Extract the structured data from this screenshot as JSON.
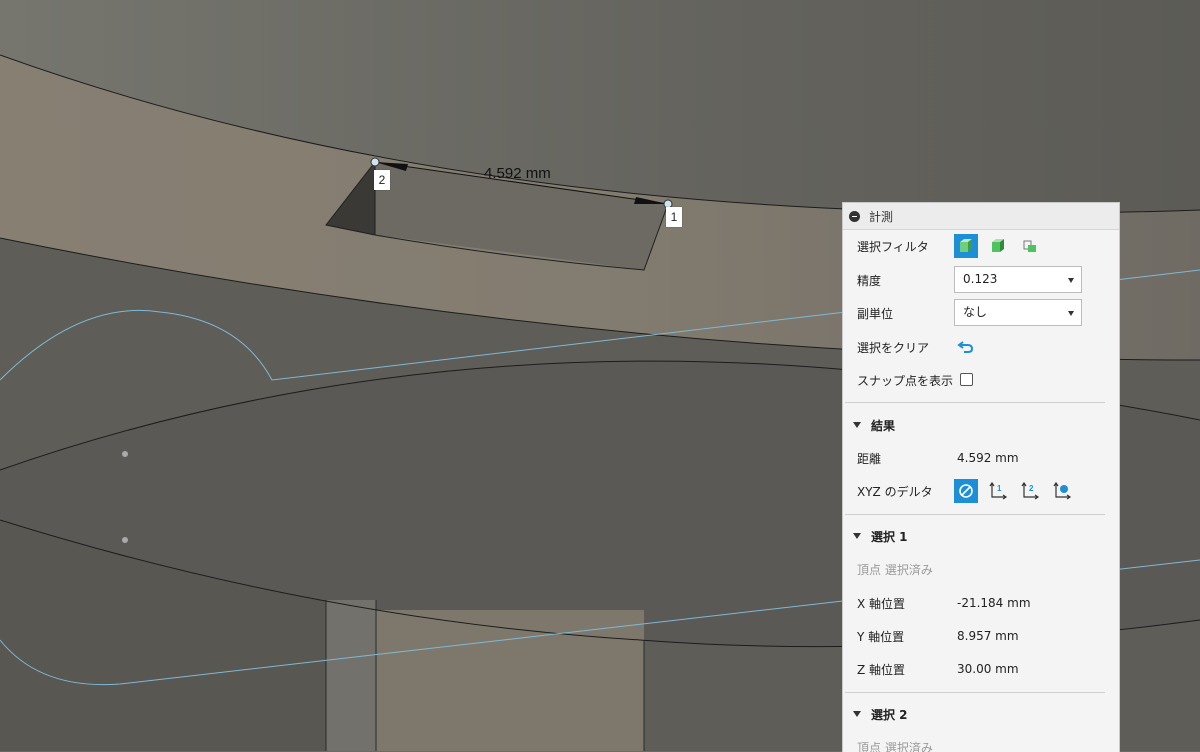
{
  "viewport": {
    "dimension_value": "4.592 mm",
    "point_labels": [
      "2",
      "1"
    ]
  },
  "panel": {
    "title": "計測",
    "selection_filter_label": "選択フィルタ",
    "filter_icons": [
      "body-filter-icon",
      "face-filter-icon",
      "edge-filter-icon"
    ],
    "precision_label": "精度",
    "precision_value": "0.123",
    "secondary_units_label": "副単位",
    "secondary_units_value": "なし",
    "clear_selection_label": "選択をクリア",
    "show_snap_points_label": "スナップ点を表示",
    "show_snap_points_checked": false,
    "results": {
      "heading": "結果",
      "distance_label": "距離",
      "distance_value": "4.592 mm",
      "xyz_delta_label": "XYZ のデルタ"
    },
    "selection1": {
      "heading": "選択 1",
      "subtitle": "頂点 選択済み",
      "x_label": "X 軸位置",
      "x_value": "-21.184 mm",
      "y_label": "Y 軸位置",
      "y_value": "8.957 mm",
      "z_label": "Z 軸位置",
      "z_value": "30.00 mm"
    },
    "selection2": {
      "heading": "選択 2",
      "subtitle": "頂点 選択済み"
    }
  },
  "colors": {
    "accent": "#1d8fd6",
    "sketch_curve": "#7fb9d6",
    "model_surface": "#7d786e"
  }
}
